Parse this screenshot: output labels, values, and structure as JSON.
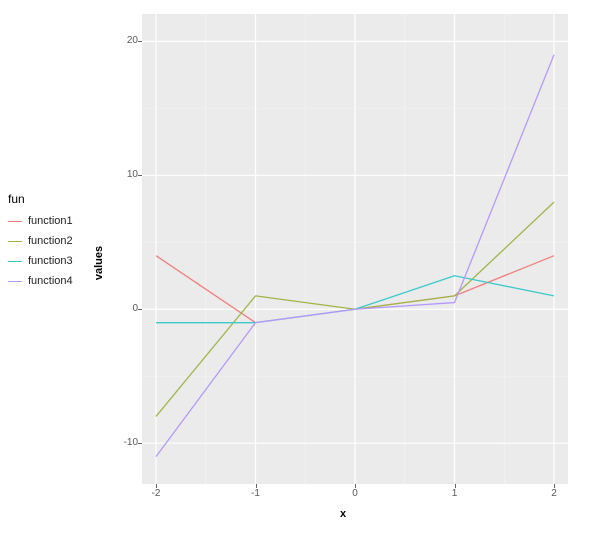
{
  "chart_data": {
    "type": "line",
    "x": [
      -2,
      -1,
      0,
      1,
      2
    ],
    "series": [
      {
        "name": "function1",
        "color": "#f47f7c",
        "values": [
          4,
          -1,
          0,
          1,
          4
        ]
      },
      {
        "name": "function2",
        "color": "#9fb54a",
        "values": [
          -8,
          1,
          0,
          1,
          8
        ]
      },
      {
        "name": "function3",
        "color": "#3ec9c9",
        "values": [
          -1,
          -1,
          0,
          2.5,
          1
        ]
      },
      {
        "name": "function4",
        "color": "#b598ff",
        "values": [
          -11,
          -1,
          0,
          0.5,
          19
        ]
      }
    ],
    "xlabel": "x",
    "ylabel": "values",
    "xlim": [
      -2,
      2
    ],
    "ylim": [
      -12,
      21
    ],
    "xticks": [
      -2,
      -1,
      0,
      1,
      2
    ],
    "yticks": [
      -10,
      0,
      10,
      20
    ],
    "legend_title": "fun",
    "legend_position": "left",
    "grid": true,
    "panel_bg": "#ebebeb",
    "grid_major": "#ffffff"
  }
}
